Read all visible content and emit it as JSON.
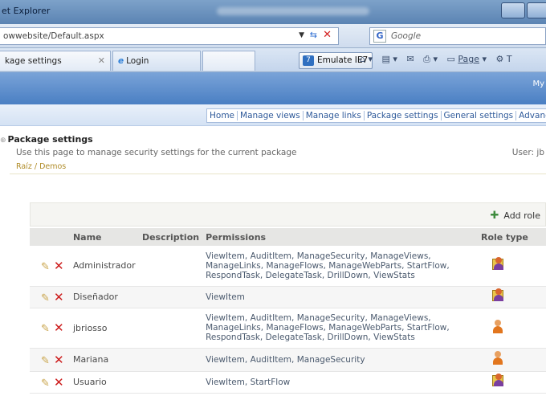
{
  "browser": {
    "title": "et Explorer",
    "address": "owwebsite/Default.aspx",
    "search_placeholder": "Google",
    "tabs": [
      {
        "label": "kage settings",
        "active": false
      },
      {
        "label": "Login",
        "active": true
      }
    ],
    "emulate_label": "Emulate IE7",
    "page_menu_label": "Page",
    "tools_menu_label": "T"
  },
  "site": {
    "banner_text": "My",
    "nav": [
      "Home",
      "Manage views",
      "Manage links",
      "Package settings",
      "General settings",
      "Advanced s"
    ]
  },
  "page": {
    "title": "Package settings",
    "description": "Use this page to manage security settings for the current package",
    "user": "User: jb",
    "breadcrumb": "Raíz / Demos"
  },
  "toolbar": {
    "add_role_label": "Add role"
  },
  "table": {
    "columns": {
      "name": "Name",
      "description": "Description",
      "permissions": "Permissions",
      "role_type": "Role type"
    },
    "rows": [
      {
        "name": "Administrador",
        "description": "",
        "permissions": "ViewItem, AuditItem, ManageSecurity, ManageViews, ManageLinks, ManageFlows, ManageWebParts, StartFlow, RespondTask, DelegateTask, DrillDown, ViewStats",
        "role_type_icon": "group-icon"
      },
      {
        "name": "Diseñador",
        "description": "",
        "permissions": "ViewItem",
        "role_type_icon": "group-icon"
      },
      {
        "name": "jbriosso",
        "description": "",
        "permissions": "ViewItem, AuditItem, ManageSecurity, ManageViews, ManageLinks, ManageFlows, ManageWebParts, StartFlow, RespondTask, DelegateTask, DrillDown, ViewStats",
        "role_type_icon": "user-icon"
      },
      {
        "name": "Mariana",
        "description": "",
        "permissions": "ViewItem, AuditItem, ManageSecurity",
        "role_type_icon": "user-icon"
      },
      {
        "name": "Usuario",
        "description": "",
        "permissions": "ViewItem, StartFlow",
        "role_type_icon": "group-icon"
      }
    ]
  }
}
